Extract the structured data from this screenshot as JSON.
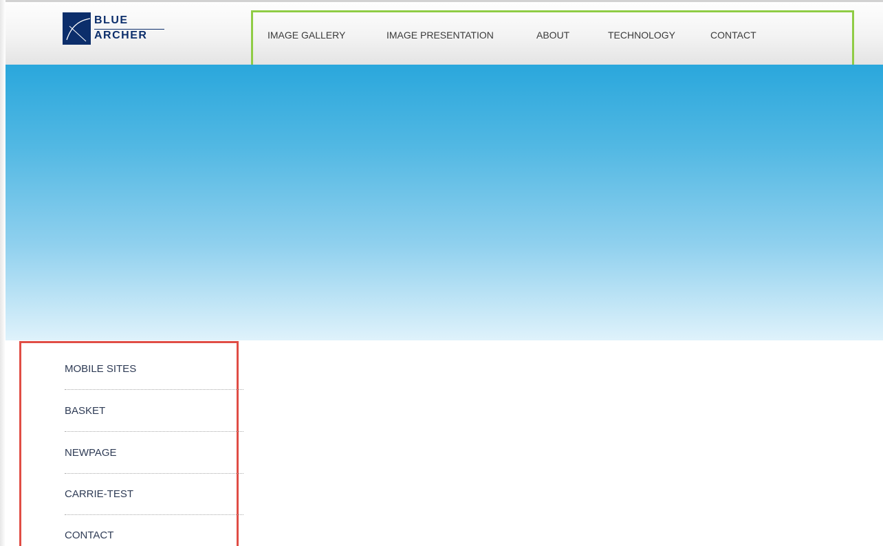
{
  "brand": {
    "line1": "BLUE",
    "line2": "ARCHER",
    "color": "#0c2e6b"
  },
  "topnav": {
    "items": [
      {
        "label": "IMAGE GALLERY"
      },
      {
        "label": "IMAGE PRESENTATION"
      },
      {
        "label": "ABOUT"
      },
      {
        "label": "TECHNOLOGY"
      },
      {
        "label": "CONTACT"
      }
    ],
    "highlight_color": "#8fcc45"
  },
  "hero": {
    "gradient_top": "#2aa7dc",
    "gradient_bottom": "#dff2fb"
  },
  "sidenav": {
    "items": [
      {
        "label": "MOBILE SITES"
      },
      {
        "label": "BASKET"
      },
      {
        "label": "NEWPAGE"
      },
      {
        "label": "CARRIE-TEST"
      },
      {
        "label": "CONTACT"
      }
    ],
    "highlight_color": "#e04d45"
  }
}
